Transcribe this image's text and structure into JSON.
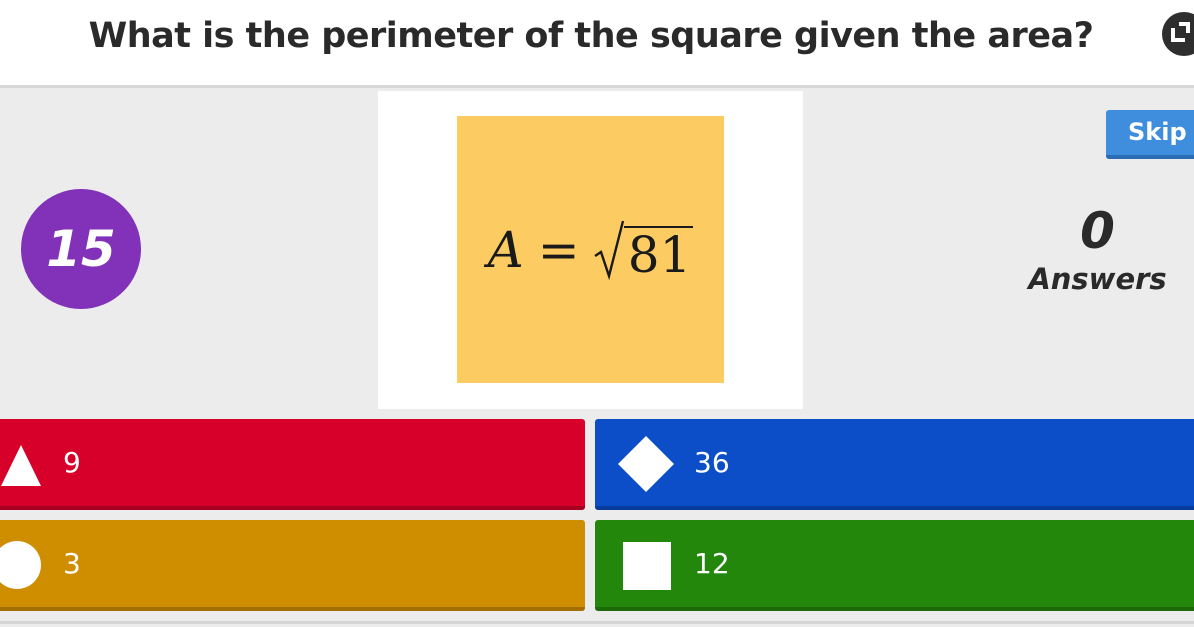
{
  "question": {
    "title": "What is the perimeter of the square given the area?"
  },
  "media": {
    "formula_variable": "A",
    "formula_equals": "=",
    "formula_radicand": "81",
    "card_color": "#fccc63"
  },
  "timer": {
    "seconds": "15",
    "color": "#8132b8"
  },
  "skip": {
    "label": "Skip",
    "color": "#3f8ede"
  },
  "answers_count": {
    "value": "0",
    "label": "Answers"
  },
  "choices": [
    {
      "shape": "triangle-icon",
      "text": "9",
      "color": "#d6002a"
    },
    {
      "shape": "diamond-icon",
      "text": "36",
      "color": "#0b4ec8"
    },
    {
      "shape": "circle-icon",
      "text": "3",
      "color": "#cf8d00"
    },
    {
      "shape": "square-icon",
      "text": "12",
      "color": "#23870b"
    }
  ]
}
